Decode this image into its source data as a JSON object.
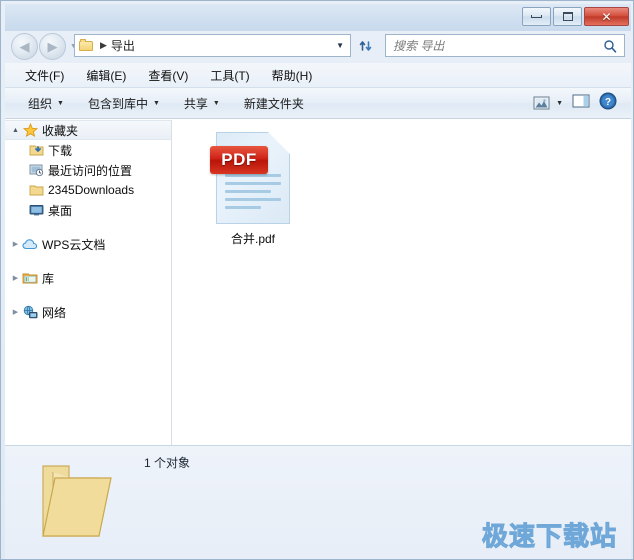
{
  "window": {
    "controls": {
      "minimize": "minimize-button",
      "maximize": "maximize-button",
      "close_label": "✕"
    }
  },
  "navigation": {
    "back_label": "◀",
    "forward_label": "▶",
    "history_caret": "▼",
    "address": {
      "folder_name": "导出",
      "separator": "▶",
      "caret": "▼"
    },
    "refresh_icon": "refresh-icon",
    "search": {
      "placeholder": "搜索 导出",
      "value": ""
    }
  },
  "menubar": {
    "items": [
      {
        "label": "文件(F)"
      },
      {
        "label": "编辑(E)"
      },
      {
        "label": "查看(V)"
      },
      {
        "label": "工具(T)"
      },
      {
        "label": "帮助(H)"
      }
    ]
  },
  "toolbar": {
    "items": [
      {
        "label": "组织",
        "caret": "▼"
      },
      {
        "label": "包含到库中",
        "caret": "▼"
      },
      {
        "label": "共享",
        "caret": "▼"
      },
      {
        "label": "新建文件夹",
        "caret": ""
      }
    ],
    "view_caret": "▼",
    "icons": {
      "view_mode": "view-mode-icon",
      "preview_pane": "preview-pane-icon",
      "help": "help-icon",
      "help_glyph": "?"
    }
  },
  "sidebar": {
    "groups": [
      {
        "name": "favorites",
        "root": {
          "label": "收藏夹",
          "icon": "star-icon",
          "expander": "▲",
          "expanded": true
        },
        "children": [
          {
            "label": "下载",
            "icon": "downloads-folder-icon"
          },
          {
            "label": "最近访问的位置",
            "icon": "recent-places-icon"
          },
          {
            "label": "2345Downloads",
            "icon": "folder-icon"
          },
          {
            "label": "桌面",
            "icon": "desktop-icon"
          }
        ]
      },
      {
        "name": "wps-cloud",
        "root": {
          "label": "WPS云文档",
          "icon": "cloud-icon",
          "expander": "▶",
          "expanded": false
        },
        "children": []
      },
      {
        "name": "libraries",
        "root": {
          "label": "库",
          "icon": "library-icon",
          "expander": "▶",
          "expanded": false
        },
        "children": []
      },
      {
        "name": "network",
        "root": {
          "label": "网络",
          "icon": "network-icon",
          "expander": "▶",
          "expanded": false
        },
        "children": []
      }
    ]
  },
  "content": {
    "files": [
      {
        "name": "合并.pdf",
        "icon": "pdf-file-icon",
        "badge": "PDF",
        "selected": false
      }
    ]
  },
  "statusbar": {
    "folder_icon": "open-folder-icon",
    "item_count": "1 个对象"
  },
  "watermark": {
    "text": "极速下载站"
  },
  "colors": {
    "accent": "#4a7fb5",
    "pdf_red": "#cf2418",
    "folder_yellow": "#f2d78c",
    "watermark": "#bcd9f2"
  }
}
